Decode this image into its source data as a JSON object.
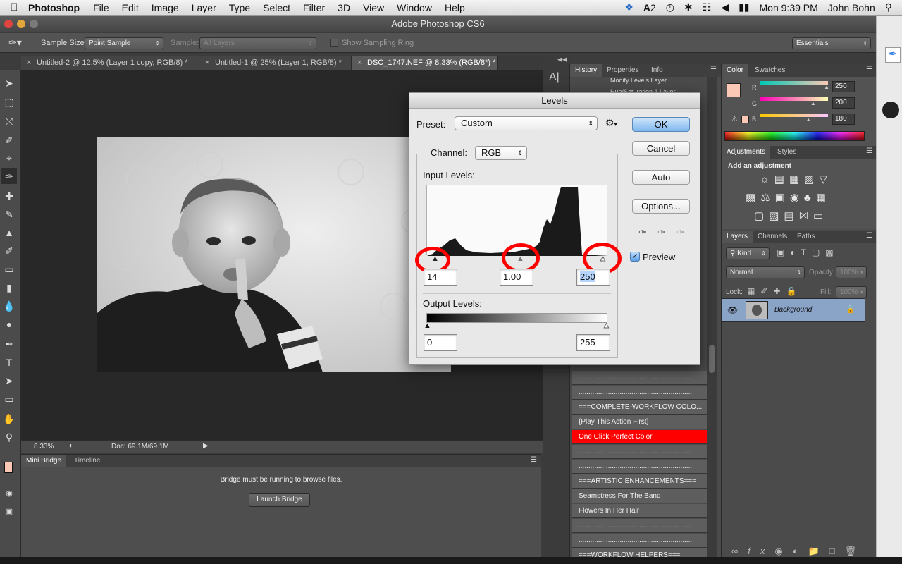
{
  "menubar": {
    "app": "Photoshop",
    "items": [
      "File",
      "Edit",
      "Image",
      "Layer",
      "Type",
      "Select",
      "Filter",
      "3D",
      "View",
      "Window",
      "Help"
    ],
    "badge_count": "2",
    "clock": "Mon 9:39 PM",
    "user": "John Bohn"
  },
  "window": {
    "title": "Adobe Photoshop CS6"
  },
  "options_bar": {
    "sample_size_label": "Sample Size:",
    "sample_size_value": "Point Sample",
    "sample_label": "Sample:",
    "sample_value": "All Layers",
    "show_sampling_ring": "Show Sampling Ring",
    "workspace": "Essentials"
  },
  "doc_tabs": [
    {
      "label": "Untitled-2 @ 12.5% (Layer 1 copy, RGB/8) *"
    },
    {
      "label": "Untitled-1 @ 25% (Layer 1, RGB/8) *"
    },
    {
      "label": "DSC_1747.NEF @ 8.33% (RGB/8*) *"
    }
  ],
  "status": {
    "zoom": "8.33%",
    "doc": "Doc: 69.1M/69.1M"
  },
  "mini_bridge": {
    "tabs": [
      "Mini Bridge",
      "Timeline"
    ],
    "message": "Bridge must be running to browse files.",
    "launch_button": "Launch Bridge"
  },
  "history_panel": {
    "tabs": [
      "History",
      "Properties",
      "Info"
    ],
    "partial_item": "Modify Levels Layer",
    "partial_item2": "Hue/Saturation 1 Layer",
    "actions": [
      {
        "label": "..........................................................",
        "selected": false
      },
      {
        "label": "===COMPLETE-WORKFLOW COLO...",
        "selected": false
      },
      {
        "label": "{Play This Action First}",
        "selected": false
      },
      {
        "label": "One Click Perfect Color",
        "selected": true
      },
      {
        "label": "..........................................................",
        "selected": false
      },
      {
        "label": "..........................................................",
        "selected": false
      },
      {
        "label": "===ARTISTIC ENHANCEMENTS===",
        "selected": false
      },
      {
        "label": "Seamstress For The Band",
        "selected": false
      },
      {
        "label": "Flowers In Her Hair",
        "selected": false
      },
      {
        "label": "..........................................................",
        "selected": false
      },
      {
        "label": "..........................................................",
        "selected": false
      },
      {
        "label": "===WORKFLOW HELPERS===",
        "selected": false
      }
    ]
  },
  "color_panel": {
    "tabs": [
      "Color",
      "Swatches"
    ],
    "channels": [
      {
        "name": "R",
        "value": "250",
        "level": 0.98
      },
      {
        "name": "G",
        "value": "200",
        "level": 0.78
      },
      {
        "name": "B",
        "value": "180",
        "level": 0.71
      }
    ],
    "foreground": "#fac8b4"
  },
  "adjustments_panel": {
    "tabs": [
      "Adjustments",
      "Styles"
    ],
    "heading": "Add an adjustment"
  },
  "layers_panel": {
    "tabs": [
      "Layers",
      "Channels",
      "Paths"
    ],
    "kind": "Kind",
    "blend_mode": "Normal",
    "opacity_label": "Opacity:",
    "opacity_value": "100%",
    "lock_label": "Lock:",
    "fill_label": "Fill:",
    "fill_value": "100%",
    "layer_name": "Background"
  },
  "levels_dialog": {
    "title": "Levels",
    "preset_label": "Preset:",
    "preset_value": "Custom",
    "channel_label": "Channel:",
    "channel_value": "RGB",
    "input_levels_label": "Input Levels:",
    "input_black": "14",
    "input_mid": "1.00",
    "input_white": "250",
    "output_levels_label": "Output Levels:",
    "output_black": "0",
    "output_white": "255",
    "ok": "OK",
    "cancel": "Cancel",
    "auto": "Auto",
    "options": "Options...",
    "preview": "Preview",
    "preview_checked": true
  },
  "colors": {
    "accent": "#ff0000",
    "layer_selected": "#8aa4c8"
  }
}
